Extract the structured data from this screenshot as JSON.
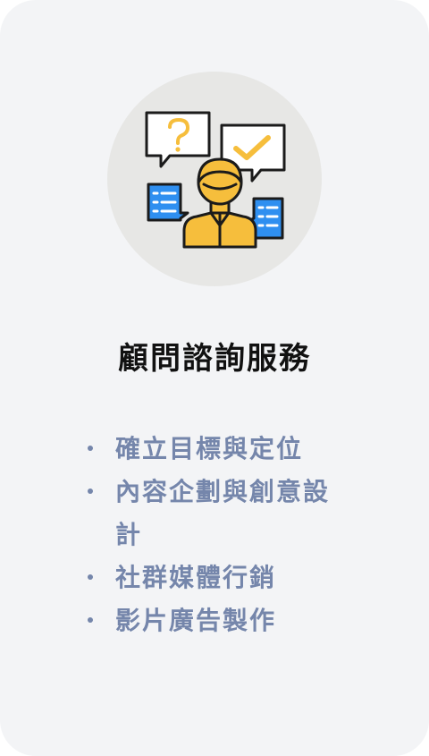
{
  "card": {
    "illustration": "consulting-person-speech-bubbles-icon",
    "title": "顧問諮詢服務",
    "items": [
      {
        "label": "確立目標與定位"
      },
      {
        "label": "內容企劃與創意設計"
      },
      {
        "label": "社群媒體行銷"
      },
      {
        "label": "影片廣告製作"
      }
    ]
  },
  "colors": {
    "card_background": "#f3f4f6",
    "icon_circle": "#e7e7e5",
    "title_text": "#111111",
    "list_text": "#7586ab",
    "accent_yellow": "#f6be3c",
    "accent_blue": "#2f8ff0"
  }
}
